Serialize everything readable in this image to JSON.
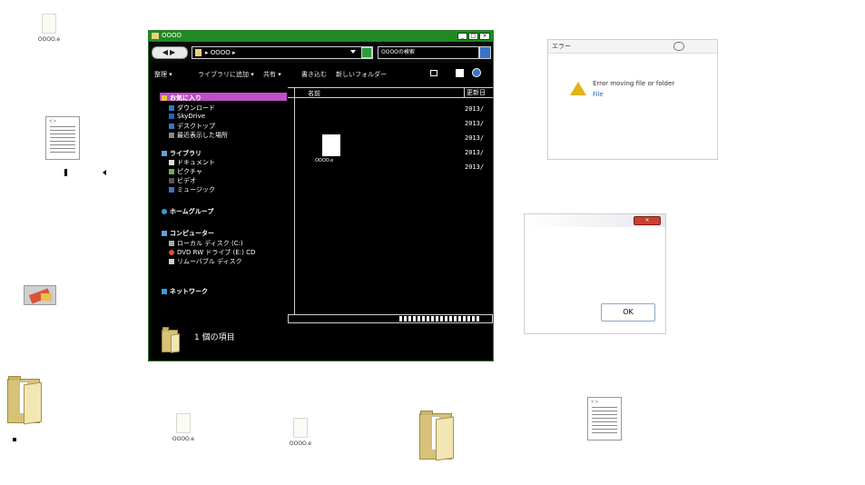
{
  "desktop_icons": [
    {
      "name": "blank-file-icon",
      "label": "OOOO.e"
    },
    {
      "name": "text-file-icon",
      "label": ""
    },
    {
      "name": "image-file-icon",
      "label": ""
    },
    {
      "name": "folder-icon",
      "label": ""
    },
    {
      "name": "blank-file-icon",
      "label": "OOOO.e"
    },
    {
      "name": "blank-file-icon",
      "label": "OOOO.e"
    },
    {
      "name": "folder-icon",
      "label": ""
    },
    {
      "name": "text-file-icon",
      "label": ""
    }
  ],
  "explorer": {
    "title": "OOOO",
    "address": "▸ OOOO ▸",
    "search_placeholder": "OOOOの検索",
    "toolbar": {
      "organize": "整理 ▾",
      "include": "ライブラリに追加 ▾",
      "share": "共有 ▾",
      "burn": "書き込む",
      "new_folder": "新しいフォルダー"
    },
    "nav": {
      "favorites": "お気に入り",
      "favorites_items": [
        "ダウンロード",
        "SkyDrive",
        "デスクトップ",
        "最近表示した場所"
      ],
      "libraries": "ライブラリ",
      "libraries_items": [
        "ドキュメント",
        "ピクチャ",
        "ビデオ",
        "ミュージック"
      ],
      "homegroup": "ホームグループ",
      "computer": "コンピューター",
      "computer_items": [
        "ローカル ディスク (C:)",
        "DVD RW ドライブ (E:) CD",
        "リムーバブル ディスク"
      ],
      "network": "ネットワーク"
    },
    "columns": {
      "name": "名前",
      "date": "更新日"
    },
    "dates": [
      "2013/",
      "2013/",
      "2013/",
      "2013/",
      "2013/"
    ],
    "file_label": "OOOO.e",
    "details_text": "1 個の項目"
  },
  "dialog1": {
    "title": "エラー",
    "message_line1": "Error moving file or folder",
    "message_line2": "File"
  },
  "dialog2": {
    "ok_label": "OK"
  },
  "colors": {
    "titlebar": "#1f8a23",
    "favorites_highlight": "#c04ec5",
    "window_bg": "#000000"
  }
}
